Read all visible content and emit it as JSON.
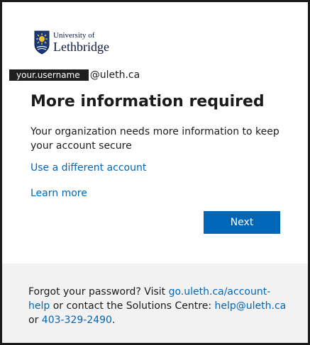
{
  "logo": {
    "line1": "University of",
    "line2": "Lethbridge"
  },
  "identity": {
    "username": "your.username",
    "domain": "@uleth.ca"
  },
  "title": "More information required",
  "description": "Your organization needs more information to keep your account secure",
  "links": {
    "different_account": "Use a different account",
    "learn_more": "Learn more"
  },
  "next_label": "Next",
  "footer": {
    "text1": "Forgot your password? Visit ",
    "help_link": "go.uleth.ca/account-help",
    "text2": " or contact the Solutions Centre: ",
    "email_link": "help@uleth.ca",
    "text3": " or ",
    "phone_link": "403-329-2490",
    "text4": "."
  },
  "colors": {
    "accent": "#0067b8",
    "footer_bg": "#f2f2f2",
    "text": "#1b1b1b"
  }
}
